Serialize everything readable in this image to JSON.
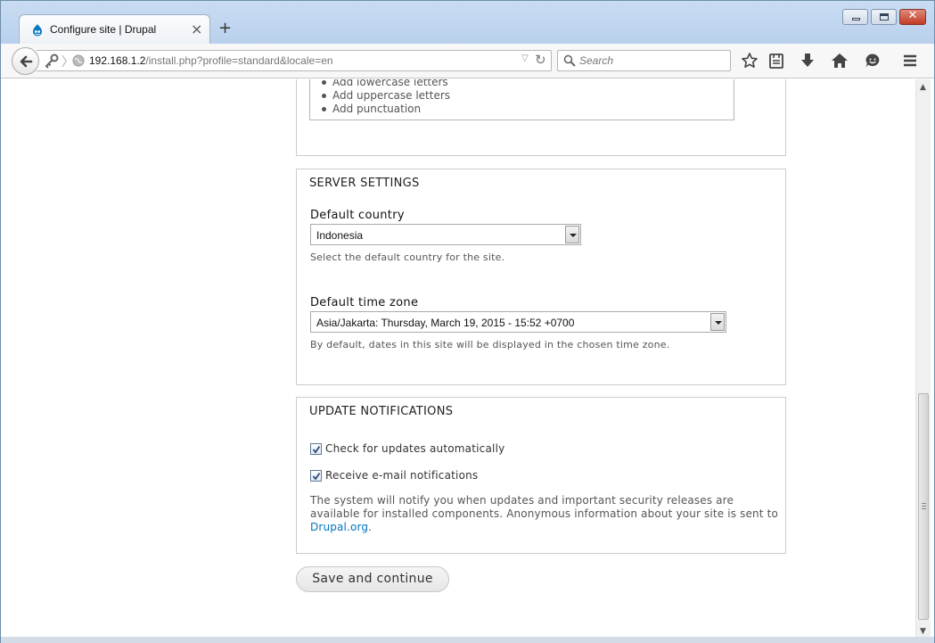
{
  "browser": {
    "tab_title": "Configure site | Drupal",
    "new_tab": "+",
    "tab_close": "×",
    "url_host": "192.168.1.2",
    "url_path": "/install.php?profile=standard&locale=en",
    "search_placeholder": "Search"
  },
  "password_hints": [
    "Add lowercase letters",
    "Add uppercase letters",
    "Add punctuation"
  ],
  "server_settings": {
    "legend": "SERVER SETTINGS",
    "country_label": "Default country",
    "country_value": "Indonesia",
    "country_desc": "Select the default country for the site.",
    "timezone_label": "Default time zone",
    "timezone_value": "Asia/Jakarta: Thursday, March 19, 2015 - 15:52 +0700",
    "timezone_desc": "By default, dates in this site will be displayed in the chosen time zone."
  },
  "update_notifications": {
    "legend": "UPDATE NOTIFICATIONS",
    "check_updates_label": "Check for updates automatically",
    "check_updates_checked": true,
    "email_label": "Receive e-mail notifications",
    "email_checked": true,
    "notice_text": "The system will notify you when updates and important security releases are available for installed components. Anonymous information about your site is sent to ",
    "notice_link": "Drupal.org",
    "notice_end": "."
  },
  "actions": {
    "save_label": "Save and continue"
  },
  "colors": {
    "link": "#0074bd",
    "drupal_blue": "#0678be"
  }
}
